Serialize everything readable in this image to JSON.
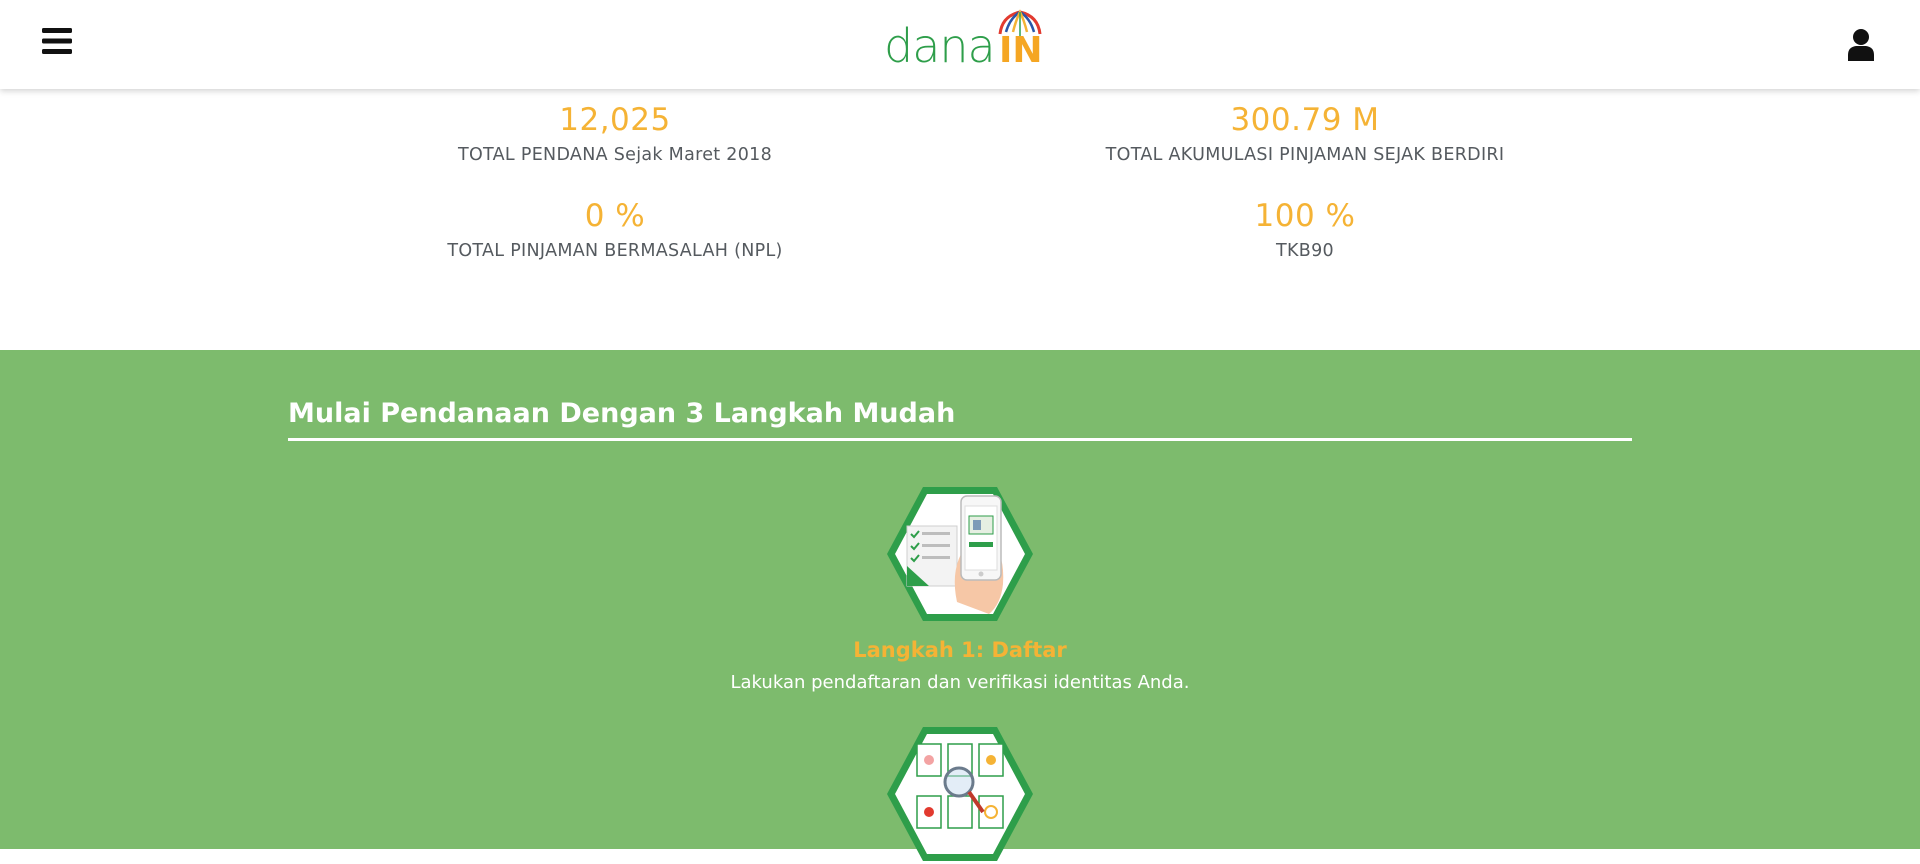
{
  "header": {
    "logo_text_main": "dana",
    "logo_text_accent": "IN",
    "menu_icon": "hamburger-menu-icon",
    "user_icon": "user-icon"
  },
  "stats": [
    {
      "value": "12,025",
      "label": "TOTAL PENDANA Sejak Maret 2018"
    },
    {
      "value": "300.79 M",
      "label": "TOTAL AKUMULASI PINJAMAN SEJAK BERDIRI"
    },
    {
      "value": "0 %",
      "label": "TOTAL PINJAMAN BERMASALAH (NPL)"
    },
    {
      "value": "100 %",
      "label": "TKB90"
    }
  ],
  "steps_section": {
    "title": "Mulai Pendanaan Dengan 3 Langkah Mudah",
    "steps": [
      {
        "title": "Langkah 1: Daftar",
        "description": "Lakukan pendaftaran dan verifikasi identitas Anda.",
        "icon": "phone-registration-icon"
      },
      {
        "title": "",
        "description": "",
        "icon": "magnifier-documents-icon"
      }
    ]
  },
  "colors": {
    "accent_orange": "#f5b335",
    "brand_green": "#7dbb6d",
    "logo_green": "#2e9e4a",
    "text_gray": "#555a5f"
  }
}
